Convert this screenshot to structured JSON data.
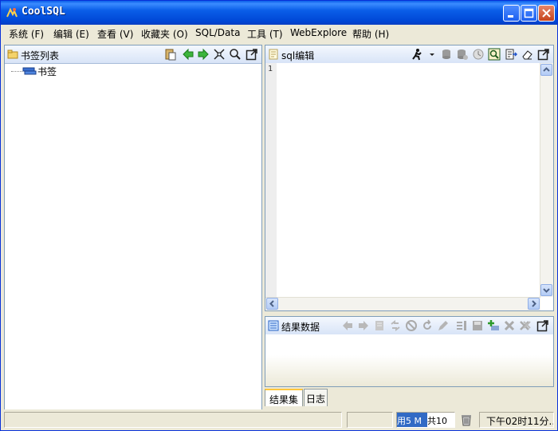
{
  "window": {
    "title": "CoolSQL"
  },
  "menu": [
    {
      "label": "系统 (F)"
    },
    {
      "label": "编辑 (E)"
    },
    {
      "label": "查看 (V)"
    },
    {
      "label": "收藏夹 (O)"
    },
    {
      "label": "SQL/Data"
    },
    {
      "label": "工具 (T)"
    },
    {
      "label": "WebExplore"
    },
    {
      "label": "帮助 (H)"
    }
  ],
  "bookmarks_panel": {
    "title": "书签列表",
    "tree_root": "书签"
  },
  "sql_panel": {
    "title": "sql编辑",
    "line_number": "1"
  },
  "result_panel": {
    "title": "结果数据"
  },
  "tabs": [
    {
      "label": "结果集"
    },
    {
      "label": "日志"
    }
  ],
  "status": {
    "memory": "用5 M",
    "total": "共10",
    "time": "下午02时11分..."
  },
  "colors": {
    "titlebar": "#0a5ee8",
    "panel_border": "#7f9db9",
    "memory_highlight": "#316ac5"
  }
}
